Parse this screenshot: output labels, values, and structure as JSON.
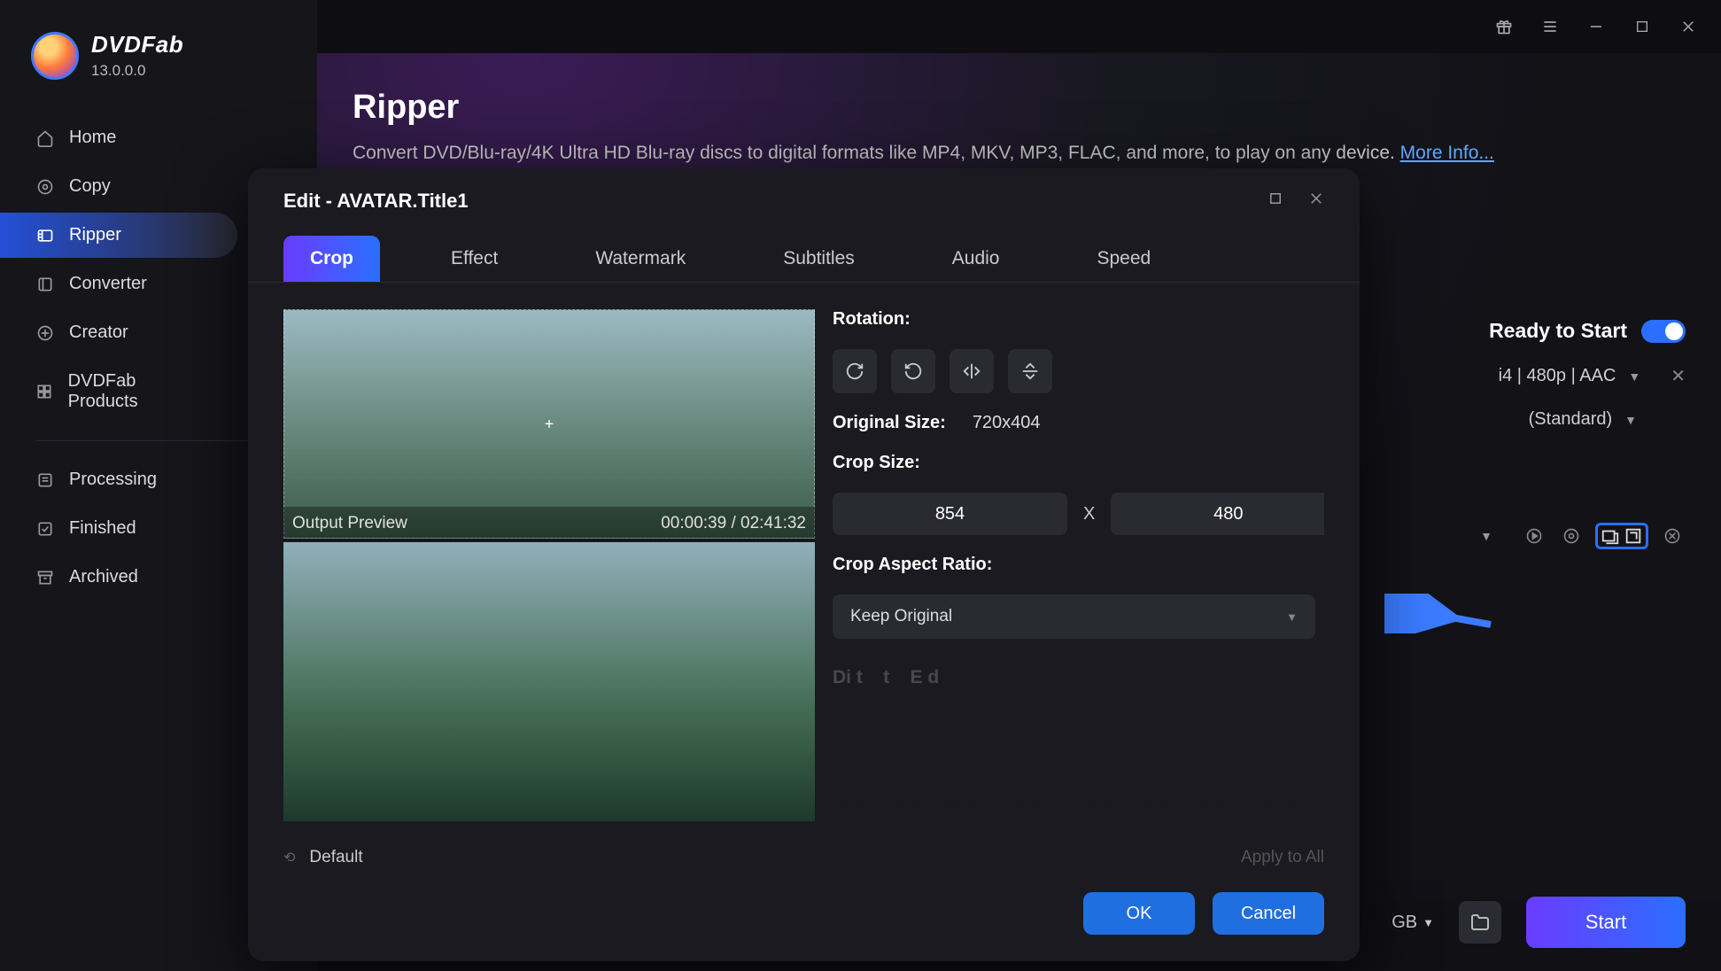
{
  "brand": {
    "name": "DVDFab",
    "version": "13.0.0.0"
  },
  "sidebar": {
    "items": [
      {
        "label": "Home"
      },
      {
        "label": "Copy"
      },
      {
        "label": "Ripper"
      },
      {
        "label": "Converter"
      },
      {
        "label": "Creator"
      },
      {
        "label": "DVDFab Products"
      }
    ],
    "items2": [
      {
        "label": "Processing"
      },
      {
        "label": "Finished"
      },
      {
        "label": "Archived"
      }
    ]
  },
  "page": {
    "title": "Ripper",
    "desc": "Convert DVD/Blu-ray/4K Ultra HD Blu-ray discs to digital formats like MP4, MKV, MP3, FLAC, and more, to play on any device. ",
    "more": "More Info..."
  },
  "right": {
    "ready": "Ready to Start",
    "format": "i4 | 480p | AAC",
    "profile": "(Standard)"
  },
  "bottom": {
    "size": "GB",
    "start": "Start"
  },
  "dialog": {
    "title": "Edit - AVATAR.Title1",
    "tabs": [
      "Crop",
      "Effect",
      "Watermark",
      "Subtitles",
      "Audio",
      "Speed"
    ],
    "outputPreview": "Output Preview",
    "timecode": "00:00:39 / 02:41:32",
    "rotationLabel": "Rotation:",
    "originalSizeLabel": "Original Size:",
    "originalSize": "720x404",
    "cropSizeLabel": "Crop Size:",
    "cropW": "854",
    "cropH": "480",
    "cropAspectLabel": "Crop Aspect Ratio:",
    "cropAspectValue": "Keep Original",
    "defaultLabel": "Default",
    "applyAll": "Apply to All",
    "ok": "OK",
    "cancel": "Cancel"
  }
}
